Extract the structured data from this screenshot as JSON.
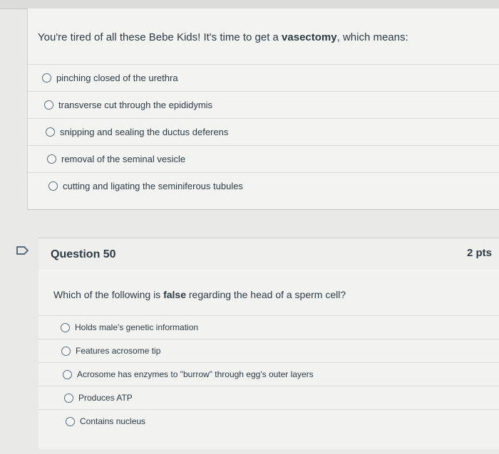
{
  "question49": {
    "text_before": "You're tired of all these Bebe Kids! It's time to get a ",
    "text_bold": "vasectomy",
    "text_after": ", which means:",
    "answers": [
      "pinching closed of the urethra",
      "transverse cut through the epididymis",
      "snipping and sealing the ductus deferens",
      "removal of the seminal vesicle",
      "cutting and ligating the seminiferous tubules"
    ]
  },
  "question50": {
    "title": "Question 50",
    "points": "2 pts",
    "text_before": "Which of the following is ",
    "text_bold": "false",
    "text_after": " regarding the head of a sperm cell?",
    "answers": [
      "Holds male's genetic information",
      "Features acrosome tip",
      "Acrosome has enzymes to \"burrow\" through egg's outer layers",
      "Produces ATP",
      "Contains nucleus"
    ]
  },
  "icons": {
    "flag": "flag-icon",
    "radio": "radio-button-icon"
  }
}
